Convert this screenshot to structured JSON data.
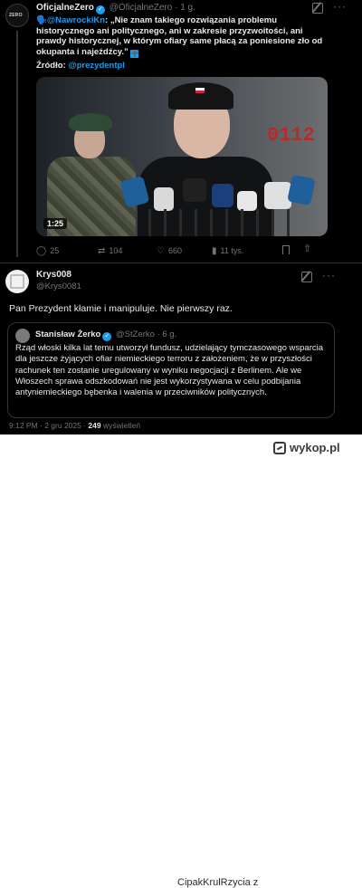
{
  "tweet": {
    "author_name": "OficjalneZero",
    "author_handle": "@OficjalneZero",
    "time": "· 1 g.",
    "mention": "@NawrockiKn",
    "text": ": „Nie znam takiego rozwiązania problemu historycznego ani politycznego, ani w zakresie przyzwoitości, ani prawdy historycznej, w którym ofiary same płacą za poniesione zło od okupanta i najeźdźcy.”",
    "source_label": "Źródło:",
    "source_mention": "@prezydentpl",
    "video_duration": "1:25",
    "video_plate": "0112",
    "avatar_text": "ZERO",
    "stats": {
      "replies": "25",
      "reposts": "104",
      "likes": "660",
      "views": "11 tys."
    }
  },
  "reply": {
    "author_name": "Krys008",
    "author_handle": "@Krys0081",
    "text": "Pan Prezydent kłamie i manipuluje. Nie pierwszy raz.",
    "quote": {
      "author_name": "Stanisław Żerko",
      "author_handle": "@StZerko",
      "time": "· 6 g.",
      "text": "Rząd włoski kilka lat temu utworzył fundusz, udzielający tymczasowego wsparcia dla jeszcze żyjących ofiar niemieckiego terroru z założeniem, że w przyszłości rachunek ten zostanie uregulowany w wyniku negocjacji z Berlinem. Ale we Włoszech sprawa odszkodowań nie jest wykorzystywana w celu podbijania antyniemieckiego bębenka i walenia w przeciwników politycznych."
    },
    "meta_time": "9:12 PM · 2 gru 2025 ·",
    "meta_views_count": "249",
    "meta_views_label": "wyświetleń"
  },
  "footer": {
    "user": "CipakKrulRzycia",
    "separator": "z",
    "site": "wykop.pl"
  },
  "icons": {
    "reply": "speech-bubble-icon",
    "repost": "repost-icon",
    "like": "heart-icon",
    "views": "bar-chart-icon",
    "bookmark": "bookmark-icon",
    "share": "share-icon"
  },
  "colors": {
    "background": "#000000",
    "accent": "#1d9bf0",
    "muted": "#71767b",
    "text": "#e7e9ea"
  }
}
